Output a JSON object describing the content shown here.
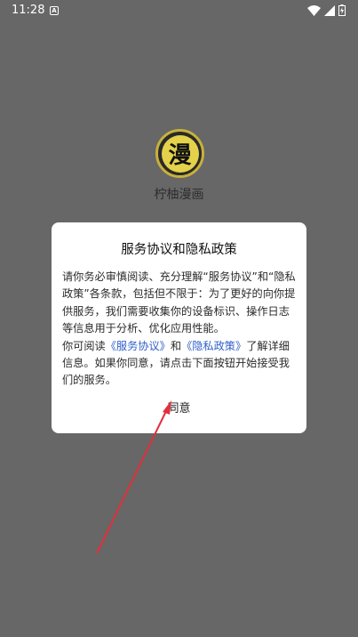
{
  "status_bar": {
    "time": "11:28",
    "notification_icon": "a-icon",
    "wifi_icon": "wifi-icon",
    "signal_icon": "signal-icon",
    "battery_icon": "battery-charging-icon"
  },
  "app": {
    "logo_glyph": "漫",
    "name": "柠柚漫画"
  },
  "dialog": {
    "title": "服务协议和隐私政策",
    "paragraph1": "请你务必审慎阅读、充分理解“服务协议”和“隐私政策”各条款，包括但不限于：为了更好的向你提供服务，我们需要收集你的设备标识、操作日志等信息用于分析、优化应用性能。",
    "p2_prefix": "你可阅读",
    "link_service": "《服务协议》",
    "p2_and": "和",
    "link_privacy": "《隐私政策》",
    "p2_suffix": "了解详细信息。如果你同意，请点击下面按钮开始接受我们的服务。",
    "agree_label": "同意"
  },
  "colors": {
    "background": "#676767",
    "dialog": "#ffffff",
    "link": "#3060c8",
    "arrow": "#e0303a"
  }
}
